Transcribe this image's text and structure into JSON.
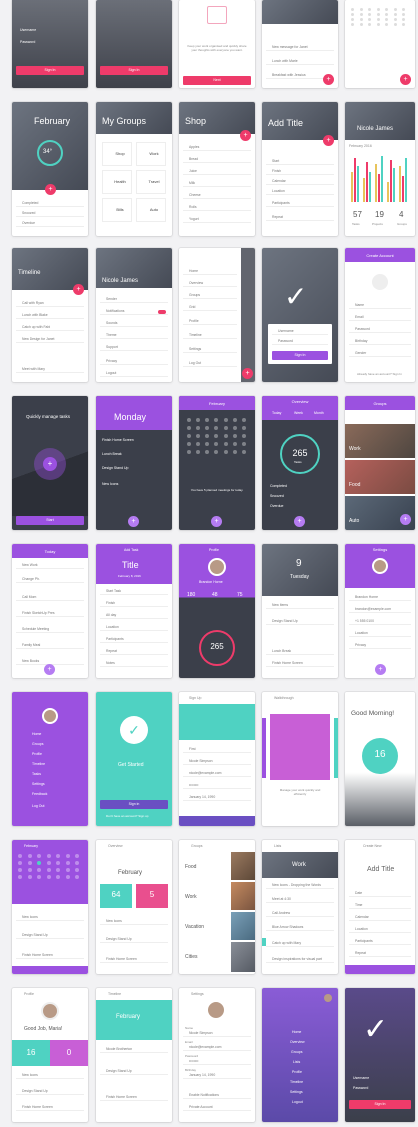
{
  "row1": {
    "signin_a": {
      "items": [
        "Username",
        "Password"
      ],
      "button": "Sign In"
    },
    "signin_b": {
      "button": "Sign In"
    },
    "confirm": {
      "message": "Keep your work organised and quickly share your thoughts with everyone you want.",
      "button": "Next"
    },
    "tasks": {
      "items": [
        "New message for Janet",
        "Lunch with Marie",
        "Breakfast with Jessica"
      ]
    }
  },
  "row2": {
    "weather": {
      "title": "February",
      "temp": "34°",
      "items": [
        "Completed",
        "Snoozed",
        "Overdue"
      ]
    },
    "groups": {
      "title": "My Groups",
      "tiles": [
        "Shop",
        "Work",
        "Health",
        "Travel",
        "Bills",
        "Auto"
      ]
    },
    "shop": {
      "title": "Shop",
      "items": [
        "Apples",
        "Bread",
        "Juice",
        "Milk",
        "Cheese",
        "Rolls",
        "Yogurt"
      ]
    },
    "addtitle": {
      "title": "Add Title",
      "fields": [
        "Start",
        "Finish",
        "Calendar",
        "Location",
        "Participants",
        "Repeat"
      ],
      "values": [
        "February 8, 2016",
        "February 8, 2016",
        "Personal",
        "",
        "",
        "Monthly"
      ]
    },
    "profile": {
      "name": "Nicole James",
      "stats": [
        "57",
        "19",
        "4"
      ],
      "stat_labels": [
        "Tasks",
        "Projects",
        "Groups"
      ],
      "chart_label": "February 2016"
    }
  },
  "row3": {
    "timeline": {
      "title": "Timeline",
      "items": [
        "Call with Ryan",
        "Lunch with Blake",
        "Catch up with Fabi",
        "New Design for Janet",
        "Meet with Mary"
      ]
    },
    "settings": {
      "name": "Nicole James",
      "items": [
        "Sender",
        "Notifications",
        "Sounds",
        "Theme",
        "Support",
        "Privacy",
        "Logout"
      ]
    },
    "menu": {
      "items": [
        "Home",
        "Overview",
        "Groups",
        "Grid",
        "Profile",
        "Timeline",
        "Settings",
        "Log Out"
      ]
    },
    "success": {
      "fields": [
        "Username",
        "Password"
      ],
      "button": "Sign In"
    },
    "create": {
      "header": "Create Account",
      "fields": [
        "Name",
        "Email",
        "Password",
        "Birthday",
        "Gender"
      ],
      "footer": "Already have an account? Sign In"
    }
  },
  "row4": {
    "quick": {
      "title": "Quickly manage tasks",
      "button": "Start"
    },
    "monday": {
      "day": "Monday",
      "items": [
        "Finish Home Screen",
        "Lunch Break",
        "Design Stand Up",
        "New Icons"
      ]
    },
    "calendar": {
      "header": "February",
      "message": "You have 5 planned meetings for today."
    },
    "overview": {
      "header": "Overview",
      "tabs": [
        "Today",
        "Week",
        "Month"
      ],
      "value": "265",
      "unit": "Tasks",
      "items": [
        "Completed",
        "Snoozed",
        "Overdue"
      ]
    },
    "groups_photo": {
      "header": "Groups",
      "labels": [
        "Work",
        "Food",
        "Auto"
      ]
    }
  },
  "row5": {
    "list": {
      "header": "Today",
      "items": [
        "New Work",
        "Change Ph.",
        "Call Mom",
        "Finish SketchUp Pres",
        "Schedule Meeting",
        "Family Meal",
        "New Books"
      ]
    },
    "addtask": {
      "header": "Add Task",
      "title": "Title",
      "date": "February 8, 2016",
      "fields": [
        "Start Task",
        "Finish",
        "All day",
        "Location",
        "Participants",
        "Repeat",
        "Notes"
      ]
    },
    "profile2": {
      "header": "Profile",
      "name": "Brandon Horne",
      "stats": [
        "180",
        "48",
        "75"
      ],
      "value": "265"
    },
    "day": {
      "header": "Timeline",
      "date": "9",
      "weekday": "Tuesday",
      "items": [
        "New Items",
        "Design Stand Up",
        "Lunch Break",
        "Finish Home Screen"
      ]
    },
    "edit": {
      "header": "Settings",
      "fields": [
        "Brandon Horne",
        "brandon@example.com",
        "+1 555 0100",
        "Location",
        "Privacy"
      ]
    }
  },
  "row6": {
    "sidemenu": {
      "items": [
        "Home",
        "Groups",
        "Profile",
        "Timeline",
        "Tasks",
        "Settings",
        "Feedback",
        "Log Out"
      ]
    },
    "getstarted": {
      "title": "Get Started",
      "button": "Sign in",
      "footer": "Don't have an account? Sign up"
    },
    "signup": {
      "header": "Sign Up",
      "fields": [
        "First",
        "Nicole Simpson",
        "nicole@example.com",
        "••••••••",
        "January 14, 1990"
      ]
    },
    "walkthrough": {
      "header": "Walkthrough",
      "message": "Manage your work quickly and efficiently"
    },
    "goodmorning": {
      "title": "Good Morning!",
      "value": "16"
    }
  },
  "row7": {
    "feb_cal": {
      "header": "February",
      "items": [
        "New Icons",
        "Design Stand Up",
        "Finish Home Screen"
      ]
    },
    "feb_overview": {
      "header": "Overview",
      "month": "February",
      "stats": [
        "64",
        "5"
      ],
      "items": [
        "New Icons",
        "Design Stand Up",
        "Finish Home Screen"
      ]
    },
    "groups_list": {
      "header": "Groups",
      "labels": [
        "Food",
        "Work",
        "Vacation",
        "Cities"
      ]
    },
    "lists": {
      "header": "Lists",
      "title": "Work",
      "items": [
        "New Icons - Dropping the Words",
        "Meet at 4:30",
        "Call Andrew",
        "Blue Arrow Shadows",
        "Catch up with Mary",
        "Design inspirations for visual part"
      ]
    },
    "addtitle2": {
      "header": "Create New",
      "title": "Add Title",
      "fields": [
        "Date",
        "Time",
        "Calendar",
        "Location",
        "Participants",
        "Repeat"
      ]
    }
  },
  "row8": {
    "profile3": {
      "header": "Profile",
      "greeting": "Good Job, Maria!",
      "stats": [
        "16",
        "0"
      ],
      "items": [
        "New Icons",
        "Design Stand Up",
        "Finish Home Screen"
      ]
    },
    "timeline2": {
      "header": "Timeline",
      "month": "February",
      "items": [
        "Nicole Brotherton",
        "Design Stand Up",
        "Finish Home Screen"
      ]
    },
    "settings2": {
      "header": "Settings",
      "items": [
        "Name",
        "Nicole Simpson",
        "Email",
        "nicole@example.com",
        "Password",
        "••••••••",
        "Birthday",
        "January 14, 1990",
        "Enable Notifications",
        "Private Account"
      ]
    },
    "navmenu": {
      "items": [
        "Home",
        "Overview",
        "Groups",
        "Lists",
        "Profile",
        "Timeline",
        "Settings",
        "Logout"
      ]
    },
    "done": {
      "fields": [
        "Username",
        "Password"
      ],
      "button": "Sign In"
    }
  },
  "colors": {
    "pink": "#ee3b6a",
    "purple": "#9b51e0",
    "teal": "#4fd2c2",
    "dark": "#3b3f4a"
  }
}
